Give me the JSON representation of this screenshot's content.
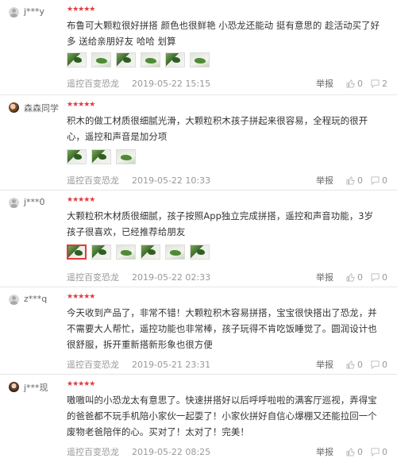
{
  "reviews": [
    {
      "username": "j***y",
      "avatar": "default-avatar",
      "stars": "★★★★★",
      "content": "布鲁可大颗粒很好拼搭 颜色也很鲜艳 小恐龙还能动 挺有意思的 趁活动买了好多 送给亲朋好友 哈哈 划算",
      "product": "遥控百变恐龙",
      "date": "2019-05-22 15:15",
      "report": "举报",
      "likes": "0",
      "comments": "2"
    },
    {
      "username": "森森同学",
      "avatar": "user-photo",
      "stars": "★★★★★",
      "content": "积木的做工材质很细腻光滑，大颗粒积木孩子拼起来很容易，全程玩的很开心，遥控和声音是加分项",
      "product": "遥控百变恐龙",
      "date": "2019-05-22 10:33",
      "report": "举报",
      "likes": "0",
      "comments": "0"
    },
    {
      "username": "j***0",
      "avatar": "default-avatar",
      "stars": "★★★★★",
      "content": "大颗粒积木材质很细腻，孩子按照App独立完成拼搭，遥控和声音功能，3岁孩子很喜欢，已经推荐给朋友",
      "product": "遥控百变恐龙",
      "date": "2019-05-22 02:33",
      "report": "举报",
      "likes": "0",
      "comments": "0"
    },
    {
      "username": "z***q",
      "avatar": "default-avatar",
      "stars": "★★★★★",
      "content": "今天收到产品了，非常不错！大颗粒积木容易拼搭，宝宝很快搭出了恐龙，并不需要大人帮忙，遥控功能也非常棒，孩子玩得不肯吃饭睡觉了。圆润设计也很舒服，拆开重新搭新形象也很方便",
      "product": "遥控百变恐龙",
      "date": "2019-05-21 23:31",
      "report": "举报",
      "likes": "0",
      "comments": "0"
    },
    {
      "username": "j***现",
      "avatar": "user-photo",
      "stars": "★★★★★",
      "content": "嗷嗷叫的小恐龙太有意思了。快速拼搭好以后呼呼啦啦的满客厅巡视，弄得宝的爸爸都不玩手机陪小家伙一起耍了！小家伙拼好自信心爆棚又还能拉回一个废物老爸陪伴的心。买对了！太对了！完美！",
      "product": "遥控百变恐龙",
      "date": "2019-05-22 08:25",
      "report": "举报",
      "likes": "0",
      "comments": "0"
    }
  ],
  "colors": {
    "star": "#e4393c",
    "meta": "#999999",
    "text": "#333333",
    "divider": "#e6e6e6"
  }
}
